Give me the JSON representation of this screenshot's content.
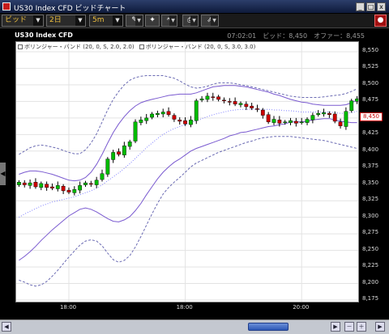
{
  "window": {
    "title": "US30 Index CFD ビッドチャート",
    "buttons": [
      "_",
      "□",
      "x"
    ]
  },
  "toolbar": {
    "price_type": "ビッド",
    "period": "2日",
    "interval": "5m",
    "tool_icons": [
      "draw-line-icon",
      "pin-icon",
      "indicator-icon",
      "print-icon",
      "export-icon",
      "alert-icon"
    ]
  },
  "chart": {
    "symbol": "US30 Index CFD",
    "status": "07:02:01　ビッド：8,450　オファー：8,455",
    "legend": [
      "ボリンジャー・バンド (20, 0, S, 2.0, 2.0)",
      "ボリンジャー・バンド (20, 0, S, 3.0, 3.0)"
    ],
    "current_price_label": "8,450",
    "colors": {
      "up": "#00bb00",
      "down": "#cc0000",
      "band2": "#7a5ad0",
      "band3": "#6b6bb3",
      "mid": "#7f7fff"
    }
  },
  "chart_data": {
    "type": "candlestick",
    "yaxis_ticks": [
      "8,550",
      "8,525",
      "8,500",
      "8,475",
      "8,450",
      "8,425",
      "8,400",
      "8,375",
      "8,350",
      "8,325",
      "8,300",
      "8,275",
      "8,250",
      "8,225",
      "8,200",
      "8,175"
    ],
    "ylim": [
      8175,
      8550
    ],
    "xaxis_ticks": [
      {
        "label": "18:00",
        "bar": 9
      },
      {
        "label": "18:00",
        "bar": 30
      },
      {
        "label": "20:00",
        "bar": 51
      }
    ],
    "bar_count": 62,
    "candles_close": [
      8353,
      8349,
      8352,
      8346,
      8351,
      8345,
      8344,
      8348,
      8340,
      8338,
      8342,
      8348,
      8352,
      8350,
      8356,
      8366,
      8388,
      8398,
      8395,
      8408,
      8414,
      8444,
      8447,
      8450,
      8456,
      8457,
      8459,
      8455,
      8448,
      8445,
      8441,
      8447,
      8476,
      8479,
      8483,
      8481,
      8478,
      8476,
      8474,
      8471,
      8472,
      8467,
      8465,
      8463,
      8454,
      8444,
      8448,
      8442,
      8444,
      8446,
      8442,
      8444,
      8448,
      8454,
      8457,
      8458,
      8455,
      8445,
      8438,
      8460,
      8476,
      8479
    ],
    "bands": {
      "mid": [
        8300,
        8305,
        8309,
        8313,
        8317,
        8320,
        8323,
        8325,
        8327,
        8329,
        8331,
        8334,
        8337,
        8340,
        8344,
        8349,
        8355,
        8361,
        8367,
        8374,
        8381,
        8389,
        8397,
        8405,
        8412,
        8419,
        8425,
        8430,
        8434,
        8437,
        8440,
        8443,
        8446,
        8449,
        8452,
        8455,
        8457,
        8459,
        8461,
        8462,
        8463,
        8463,
        8463,
        8463,
        8463,
        8463,
        8462,
        8462,
        8461,
        8461,
        8460,
        8459,
        8459,
        8459,
        8459,
        8459,
        8459,
        8458,
        8457,
        8457,
        8458,
        8460
      ],
      "upper2": [
        8365,
        8368,
        8370,
        8370,
        8369,
        8367,
        8365,
        8362,
        8359,
        8356,
        8355,
        8356,
        8360,
        8368,
        8380,
        8395,
        8412,
        8428,
        8441,
        8452,
        8461,
        8468,
        8473,
        8476,
        8478,
        8480,
        8482,
        8484,
        8485,
        8486,
        8486,
        8486,
        8488,
        8491,
        8494,
        8497,
        8498,
        8499,
        8499,
        8499,
        8498,
        8497,
        8495,
        8493,
        8491,
        8489,
        8486,
        8484,
        8481,
        8478,
        8476,
        8474,
        8473,
        8471,
        8470,
        8469,
        8469,
        8469,
        8469,
        8470,
        8473,
        8477
      ],
      "lower2": [
        8235,
        8241,
        8248,
        8256,
        8265,
        8273,
        8281,
        8288,
        8295,
        8302,
        8307,
        8312,
        8314,
        8312,
        8308,
        8303,
        8298,
        8294,
        8293,
        8296,
        8301,
        8310,
        8321,
        8334,
        8346,
        8358,
        8368,
        8376,
        8383,
        8388,
        8394,
        8400,
        8404,
        8407,
        8410,
        8413,
        8416,
        8419,
        8423,
        8425,
        8428,
        8429,
        8431,
        8433,
        8435,
        8437,
        8438,
        8440,
        8441,
        8444,
        8444,
        8444,
        8445,
        8447,
        8448,
        8449,
        8449,
        8447,
        8445,
        8444,
        8443,
        8443
      ],
      "upper3": [
        8395,
        8400,
        8405,
        8408,
        8409,
        8408,
        8406,
        8404,
        8401,
        8398,
        8396,
        8396,
        8402,
        8412,
        8426,
        8444,
        8462,
        8478,
        8490,
        8500,
        8507,
        8511,
        8513,
        8514,
        8514,
        8514,
        8514,
        8512,
        8510,
        8506,
        8501,
        8497,
        8495,
        8496,
        8498,
        8501,
        8503,
        8503,
        8503,
        8502,
        8500,
        8499,
        8497,
        8495,
        8493,
        8491,
        8489,
        8487,
        8485,
        8483,
        8482,
        8481,
        8481,
        8481,
        8481,
        8482,
        8483,
        8484,
        8485,
        8487,
        8490,
        8494
      ],
      "lower3": [
        8205,
        8202,
        8198,
        8196,
        8198,
        8203,
        8211,
        8220,
        8230,
        8240,
        8249,
        8258,
        8264,
        8266,
        8264,
        8257,
        8246,
        8236,
        8232,
        8235,
        8242,
        8255,
        8271,
        8288,
        8305,
        8321,
        8335,
        8345,
        8353,
        8360,
        8368,
        8376,
        8382,
        8386,
        8390,
        8394,
        8398,
        8401,
        8404,
        8407,
        8410,
        8413,
        8415,
        8418,
        8420,
        8421,
        8422,
        8422,
        8422,
        8422,
        8421,
        8420,
        8419,
        8418,
        8417,
        8416,
        8414,
        8412,
        8410,
        8408,
        8406,
        8404
      ]
    }
  },
  "scrollbar": {
    "buttons": [
      "◀",
      "▶",
      "－",
      "＋",
      "▶"
    ]
  },
  "side_tab": "◀"
}
